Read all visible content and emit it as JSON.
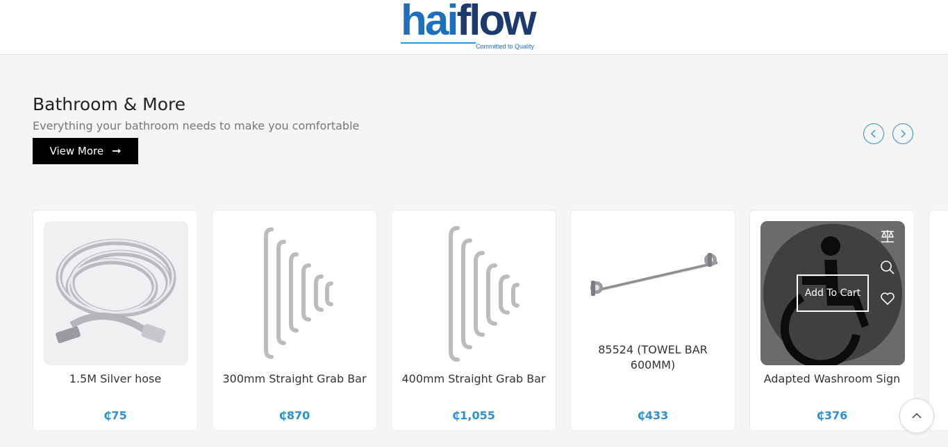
{
  "brand": {
    "name_part1": "hai",
    "name_part2": "flow",
    "tagline": "Committed to Quality"
  },
  "section": {
    "title": "Bathroom & More",
    "subtitle": "Everything your bathroom needs to make you comfortable",
    "view_more_label": "View More"
  },
  "products": [
    {
      "name": "1.5M Silver hose",
      "price": "₵75"
    },
    {
      "name": "300mm Straight Grab Bar",
      "price": "₵870"
    },
    {
      "name": "400mm Straight Grab Bar",
      "price": "₵1,055"
    },
    {
      "name": "85524 (TOWEL BAR 600MM)",
      "price": "₵433"
    },
    {
      "name": "Adapted Washroom Sign",
      "price": "₵376",
      "add_to_cart_label": "Add To Cart"
    }
  ],
  "icons": {
    "prev": "chevron-left-icon",
    "next": "chevron-right-icon",
    "compare": "compare-icon",
    "quick_view": "search-icon",
    "wishlist": "heart-icon",
    "scroll_top": "chevron-up-icon"
  },
  "colors": {
    "accent": "#2d8fd5",
    "brand_blue": "#1f6fbf",
    "brand_navy": "#1d3a6e",
    "button_bg": "#000000"
  }
}
